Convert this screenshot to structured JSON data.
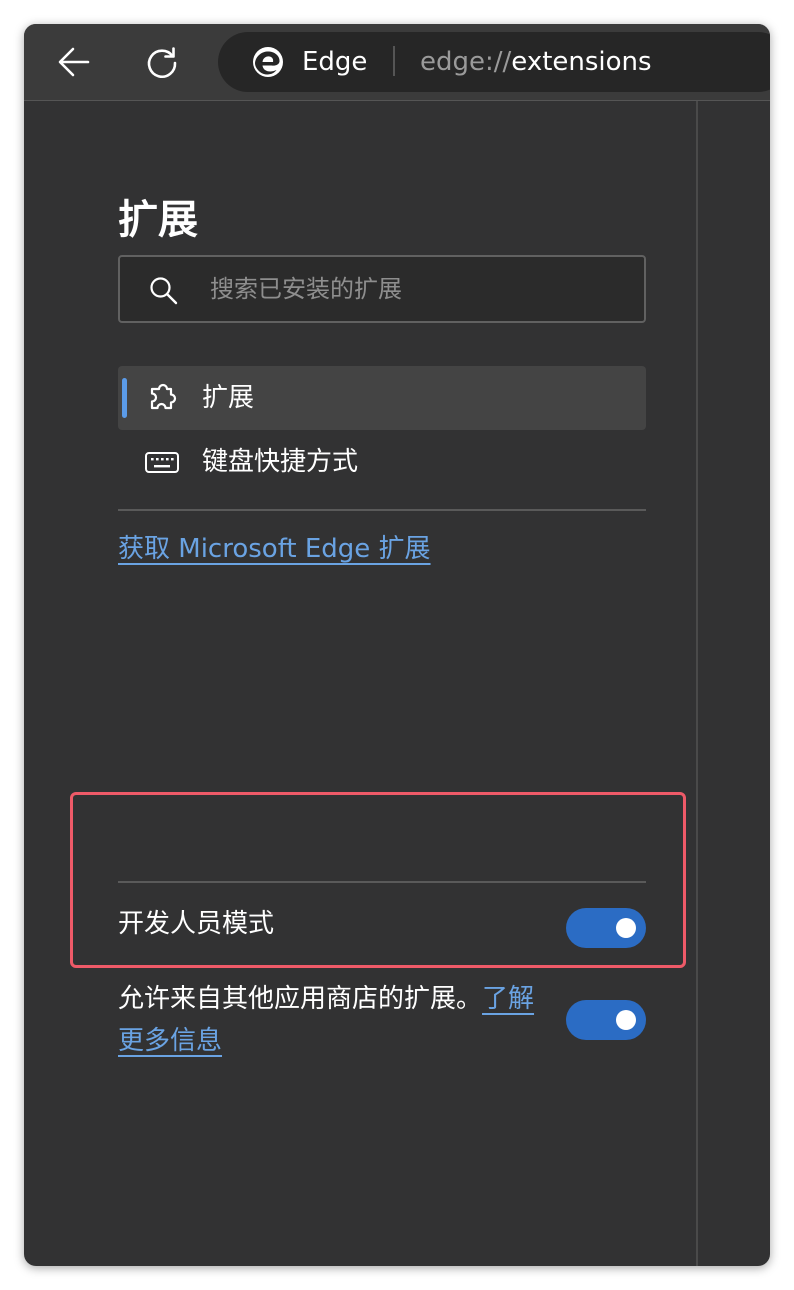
{
  "toolbar": {
    "browser_name": "Edge",
    "url_scheme": "edge://",
    "url_path": "extensions"
  },
  "sidebar": {
    "title": "扩展",
    "search": {
      "placeholder": "搜索已安装的扩展",
      "value": ""
    },
    "menu": [
      {
        "label": "扩展",
        "icon": "puzzle-icon",
        "selected": true
      },
      {
        "label": "键盘快捷方式",
        "icon": "keyboard-icon",
        "selected": false
      }
    ],
    "store_link": "获取 Microsoft Edge 扩展",
    "developer_mode": {
      "label": "开发人员模式",
      "enabled": true
    },
    "allow_other_stores": {
      "label": "允许来自其他应用商店的扩展。",
      "link": "了解更多信息",
      "enabled": true
    }
  },
  "colors": {
    "accent": "#2b6cc4",
    "link": "#6aa3e3",
    "highlight_border": "#ee5a68",
    "background": "#323233"
  }
}
